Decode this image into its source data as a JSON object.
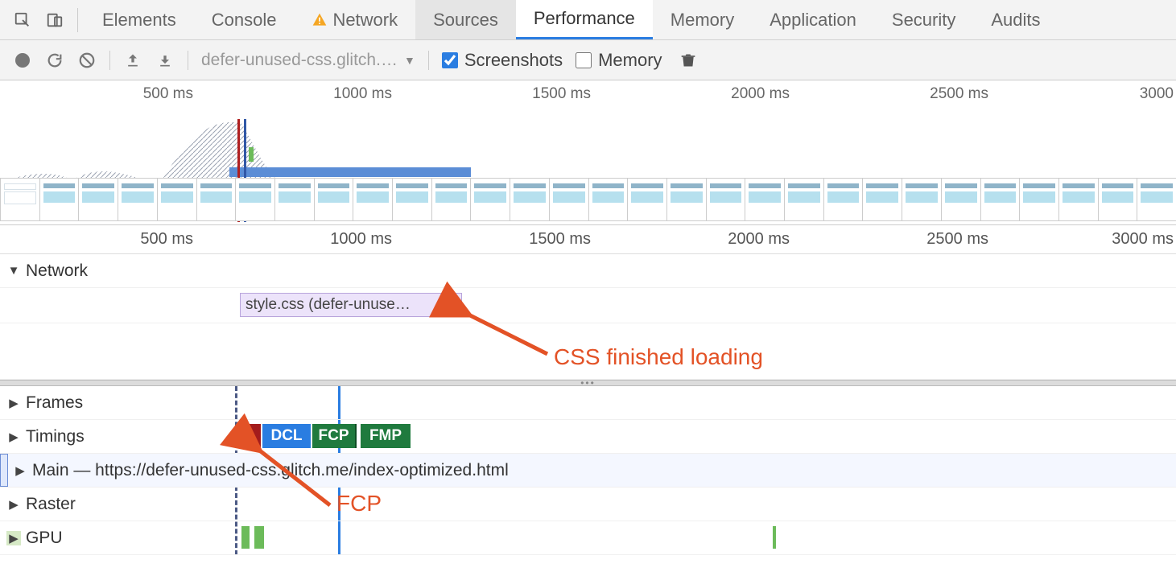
{
  "tabs": {
    "elements": "Elements",
    "console": "Console",
    "network": "Network",
    "sources": "Sources",
    "performance": "Performance",
    "memory": "Memory",
    "application": "Application",
    "security": "Security",
    "audits": "Audits"
  },
  "toolbar": {
    "dropdown": "defer-unused-css.glitch.…",
    "screenshots": "Screenshots",
    "memory": "Memory"
  },
  "ticks": {
    "t500": "500 ms",
    "t1000": "1000 ms",
    "t1500": "1500 ms",
    "t2000": "2000 ms",
    "t2500": "2500 ms",
    "t3000": "3000",
    "t3000ms": "3000 ms"
  },
  "tracks": {
    "network": "Network",
    "frames": "Frames",
    "timings": "Timings",
    "main": "Main — https://defer-unused-css.glitch.me/index-optimized.html",
    "raster": "Raster",
    "gpu": "GPU"
  },
  "network_item": "style.css (defer-unuse…",
  "timing_labels": {
    "l": "L",
    "dcl": "DCL",
    "fcp": "FCP",
    "fmp": "FMP"
  },
  "annotations": {
    "css": "CSS finished loading",
    "fcp": "FCP"
  }
}
